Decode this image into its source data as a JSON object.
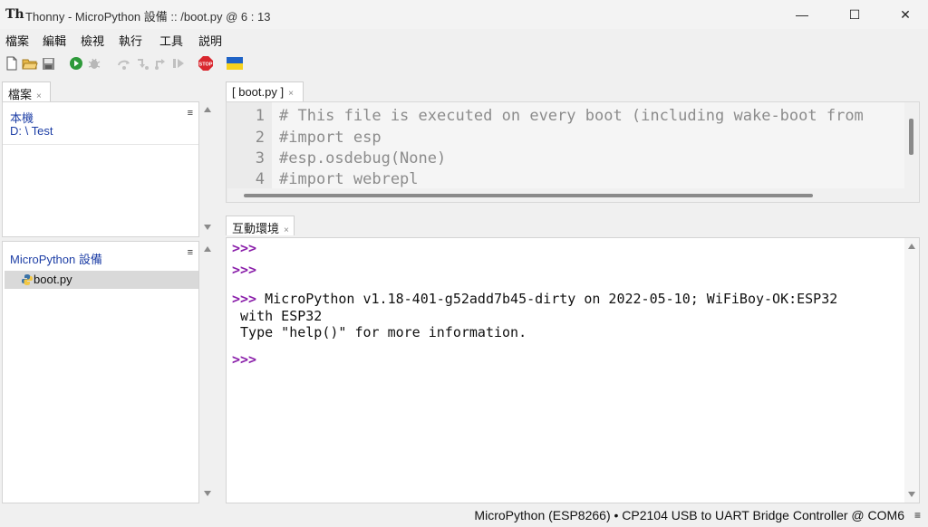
{
  "window": {
    "title": "Thonny  -  MicroPython 設備 :: /boot.py  @  6 : 13",
    "app_icon": "Th",
    "minimize": "—",
    "maximize": "☐",
    "close": "✕"
  },
  "menu": [
    "檔案",
    "編輯",
    "檢視",
    "執行",
    "工具",
    "説明"
  ],
  "toolbar": {
    "icons": [
      "new-file-icon",
      "open-folder-icon",
      "save-icon",
      "run-icon",
      "debug-icon",
      "step-over-icon",
      "step-into-icon",
      "step-out-icon",
      "resume-icon",
      "stop-icon",
      "ukraine-flag-icon"
    ],
    "stop_label": "STOP",
    "colors": {
      "run": "#2e9a3a",
      "stop": "#d9272e",
      "flag_blue": "#1f63c6",
      "flag_yellow": "#f6d21d"
    }
  },
  "files_pane": {
    "tab_label": "檔案",
    "tab_close": "×",
    "local": {
      "title": "本機",
      "path": "D: \\ Test",
      "menu": "≡"
    },
    "device": {
      "title": "MicroPython 設備",
      "menu": "≡",
      "files": [
        "boot.py"
      ]
    }
  },
  "editor": {
    "tab_label": "[ boot.py ]",
    "tab_close": "×",
    "lines": [
      {
        "num": "1",
        "text": "# This file is executed on every boot (including wake-boot from"
      },
      {
        "num": "2",
        "text": "#import esp"
      },
      {
        "num": "3",
        "text": "#esp.osdebug(None)"
      },
      {
        "num": "4",
        "text": "#import webrepl"
      }
    ]
  },
  "shell": {
    "tab_label": "互動環境",
    "tab_close": "×",
    "prompt": ">>>",
    "lines": [
      {
        "prompt": ">>>",
        "text": ""
      },
      {
        "prompt": ">>>",
        "text": ""
      },
      {
        "prompt": ">>>",
        "text": " MicroPython v1.18-401-g52add7b45-dirty on 2022-05-10; WiFiBoy-OK:ESP32"
      },
      {
        "prompt": "",
        "text": " with ESP32"
      },
      {
        "prompt": "",
        "text": " Type \"help()\" for more information."
      },
      {
        "prompt": ">>>",
        "text": ""
      }
    ],
    "prompt_color": "#8a1faa"
  },
  "status": {
    "text": "MicroPython (ESP8266)  •  CP2104 USB to UART Bridge Controller @ COM6",
    "menu": "≡"
  }
}
